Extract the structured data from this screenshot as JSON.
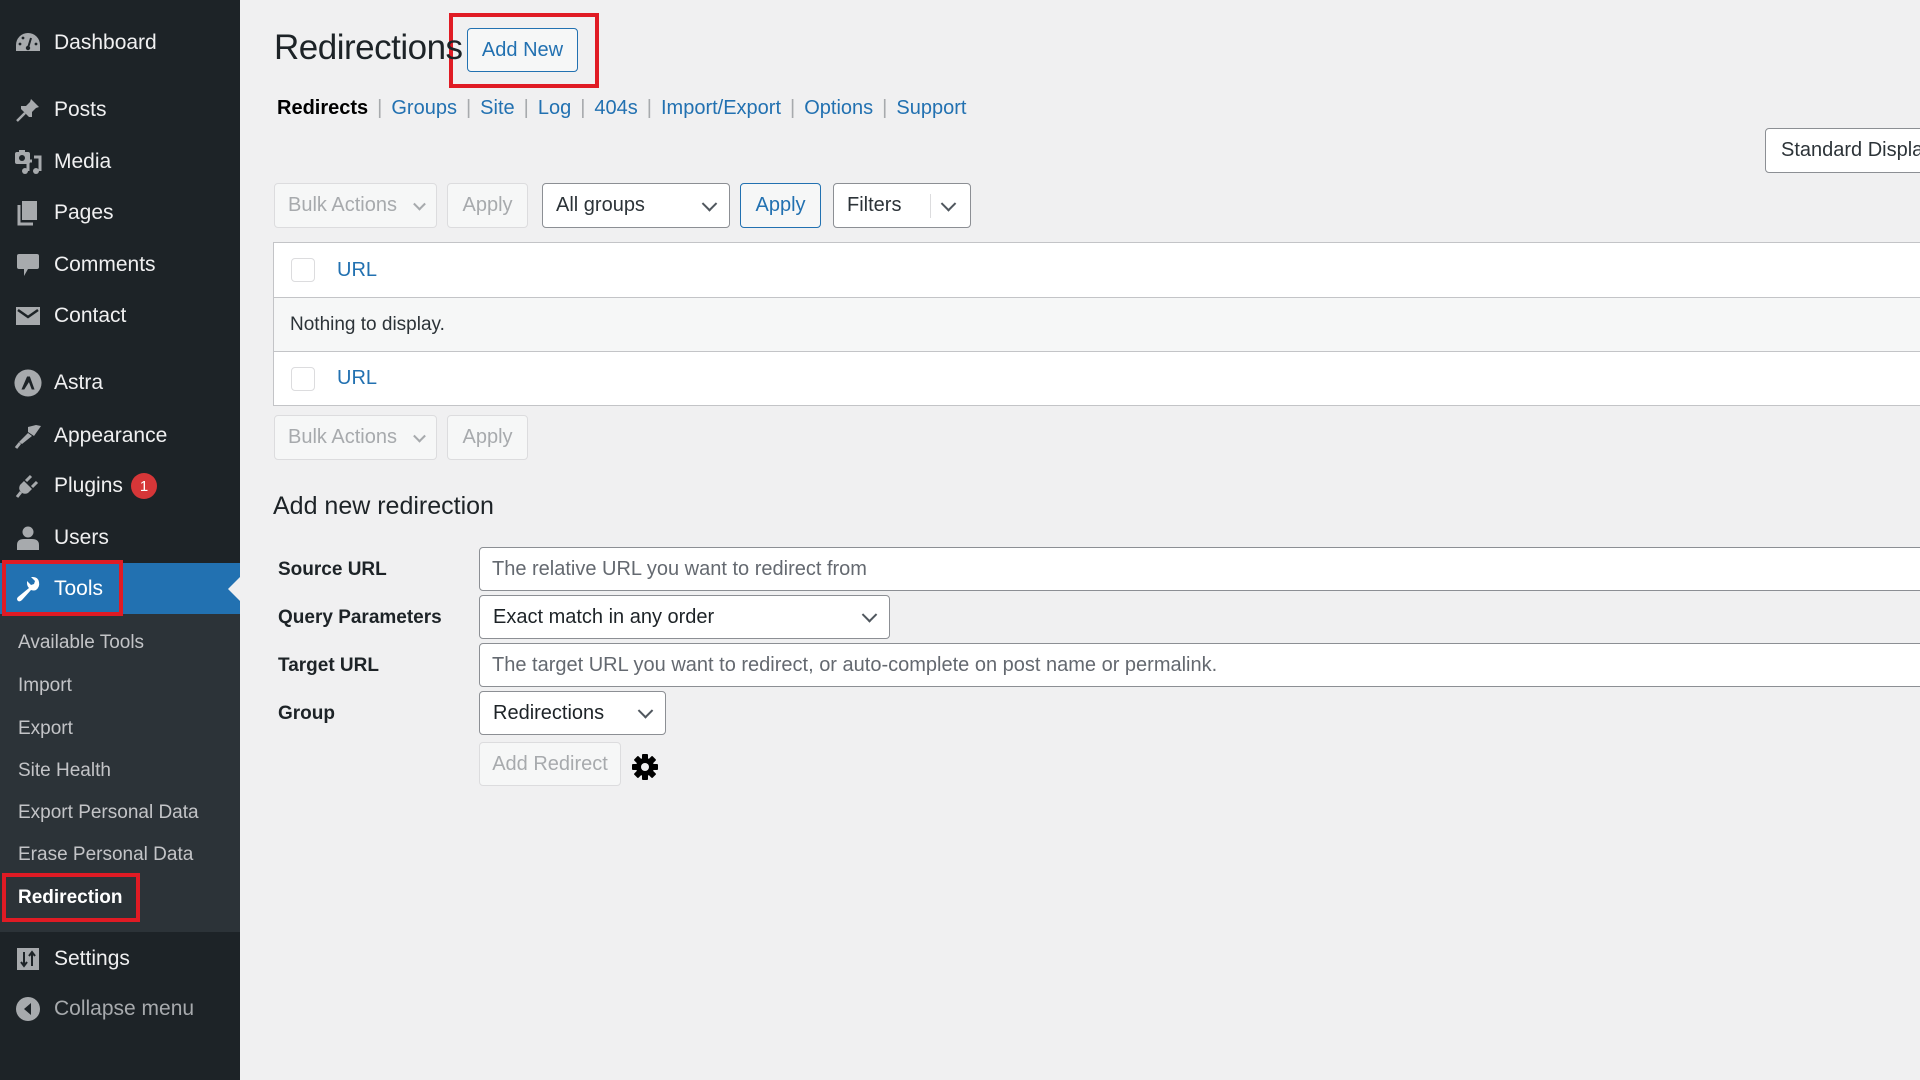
{
  "sidebar": {
    "items": [
      {
        "label": "Dashboard",
        "icon": "dashboard-icon"
      },
      {
        "label": "Posts",
        "icon": "pushpin-icon"
      },
      {
        "label": "Media",
        "icon": "media-icon"
      },
      {
        "label": "Pages",
        "icon": "pages-icon"
      },
      {
        "label": "Comments",
        "icon": "comment-icon"
      },
      {
        "label": "Contact",
        "icon": "envelope-icon"
      },
      {
        "label": "Astra",
        "icon": "astra-logo-icon"
      },
      {
        "label": "Appearance",
        "icon": "paintbrush-icon"
      },
      {
        "label": "Plugins",
        "icon": "plug-icon",
        "badge": "1"
      },
      {
        "label": "Users",
        "icon": "user-icon"
      },
      {
        "label": "Tools",
        "icon": "wrench-icon",
        "active": true
      },
      {
        "label": "Settings",
        "icon": "settings-sliders-icon"
      },
      {
        "label": "Collapse menu",
        "icon": "collapse-arrow-icon"
      }
    ],
    "submenu": [
      {
        "label": "Available Tools"
      },
      {
        "label": "Import"
      },
      {
        "label": "Export"
      },
      {
        "label": "Site Health"
      },
      {
        "label": "Export Personal Data"
      },
      {
        "label": "Erase Personal Data"
      },
      {
        "label": "Redirection",
        "current": true
      }
    ]
  },
  "header": {
    "title": "Redirections",
    "add_new_label": "Add New"
  },
  "subnav": {
    "items": [
      "Redirects",
      "Groups",
      "Site",
      "Log",
      "404s",
      "Import/Export",
      "Options",
      "Support"
    ],
    "current": "Redirects"
  },
  "display_toggle": {
    "label": "Standard Display"
  },
  "toolbar_top": {
    "bulk_actions": "Bulk Actions",
    "apply": "Apply",
    "group_filter": "All groups",
    "group_apply": "Apply",
    "filters": "Filters"
  },
  "table": {
    "column_header": "URL",
    "column_footer": "URL",
    "empty_message": "Nothing to display."
  },
  "toolbar_bottom": {
    "bulk_actions": "Bulk Actions",
    "apply": "Apply"
  },
  "add_form": {
    "heading": "Add new redirection",
    "source_label": "Source URL",
    "source_placeholder": "The relative URL you want to redirect from",
    "source_value": "",
    "query_label": "Query Parameters",
    "query_value": "Exact match in any order",
    "target_label": "Target URL",
    "target_placeholder": "The target URL you want to redirect, or auto-complete on post name or permalink.",
    "target_value": "",
    "group_label": "Group",
    "group_value": "Redirections",
    "submit_label": "Add Redirect"
  },
  "colors": {
    "sidebar_bg": "#1d2327",
    "submenu_bg": "#2c3338",
    "accent": "#2271b1",
    "badge": "#d63638",
    "highlight_box": "#e01b24"
  }
}
